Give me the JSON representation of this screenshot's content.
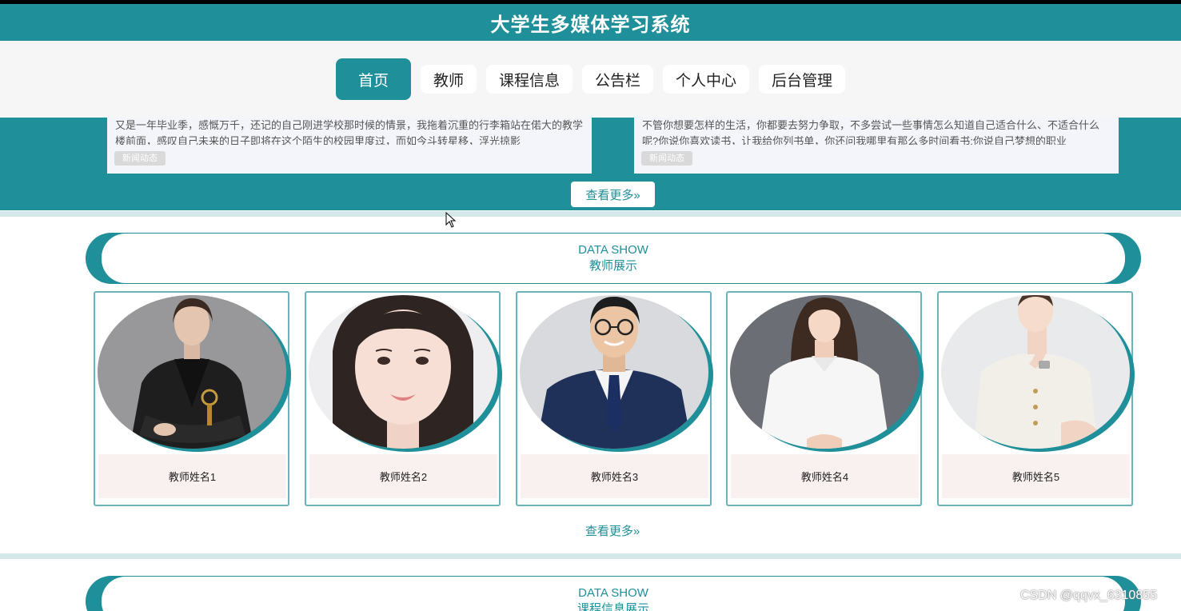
{
  "app_title": "大学生多媒体学习系统",
  "nav": [
    {
      "label": "首页",
      "active": true
    },
    {
      "label": "教师",
      "active": false
    },
    {
      "label": "课程信息",
      "active": false
    },
    {
      "label": "公告栏",
      "active": false
    },
    {
      "label": "个人中心",
      "active": false
    },
    {
      "label": "后台管理",
      "active": false
    }
  ],
  "news": [
    {
      "text": "又是一年毕业季，感慨万千，还记的自己刚进学校那时候的情景，我拖着沉重的行李箱站在偌大的教学楼前面，感叹自己未来的日子即将在这个陌生的校园里度过，而如今斗转星移，浮光掠影",
      "tag": "新闻动态"
    },
    {
      "text": "不管你想要怎样的生活，你都要去努力争取，不多尝试一些事情怎么知道自己适合什么、不适合什么呢?你说你喜欢读书，让我给你列书单，你还问我哪里有那么多时间看书;你说自己梦想的职业",
      "tag": "新闻动态"
    }
  ],
  "news_more": "查看更多»",
  "teacher_section": {
    "en": "DATA SHOW",
    "zh": "教师展示"
  },
  "teachers": [
    {
      "name": "教师姓名1"
    },
    {
      "name": "教师姓名2"
    },
    {
      "name": "教师姓名3"
    },
    {
      "name": "教师姓名4"
    },
    {
      "name": "教师姓名5"
    }
  ],
  "teacher_more": "查看更多»",
  "course_section": {
    "en": "DATA SHOW",
    "zh": "课程信息展示"
  },
  "watermark": "CSDN @qqvx_6310855",
  "colors": {
    "primary": "#1f8f99",
    "name_bg": "#f8f1ef",
    "news_bg": "#f4f5fb"
  }
}
